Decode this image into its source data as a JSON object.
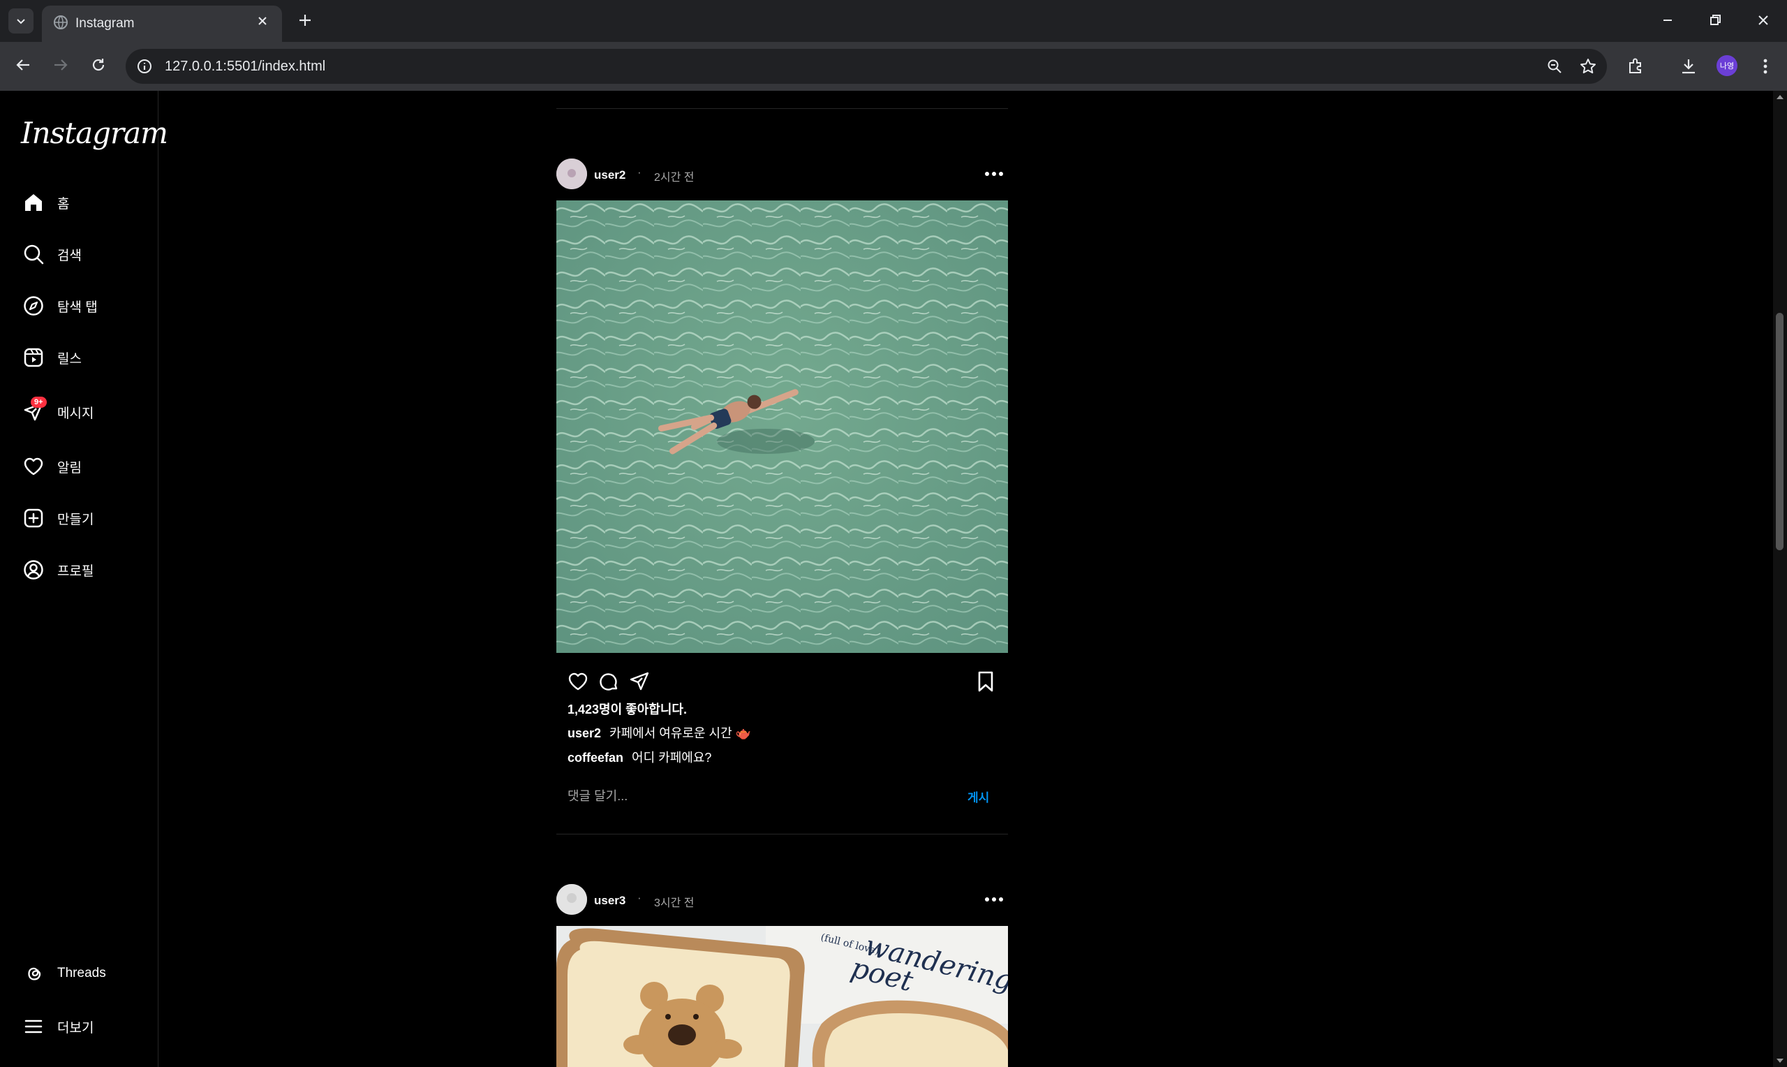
{
  "browser": {
    "tab_title": "Instagram",
    "url": "127.0.0.1:5501/index.html",
    "profile_initials": "나영"
  },
  "sidebar": {
    "logo": "Instagram",
    "items": [
      {
        "label": "홈",
        "icon": "home-icon"
      },
      {
        "label": "검색",
        "icon": "search-icon"
      },
      {
        "label": "탐색 탭",
        "icon": "compass-icon"
      },
      {
        "label": "릴스",
        "icon": "reels-icon"
      },
      {
        "label": "메시지",
        "icon": "send-icon",
        "badge": "9+"
      },
      {
        "label": "알림",
        "icon": "heart-icon"
      },
      {
        "label": "만들기",
        "icon": "plus-square-icon"
      },
      {
        "label": "프로필",
        "icon": "profile-icon"
      }
    ],
    "bottom": [
      {
        "label": "Threads",
        "icon": "threads-icon"
      },
      {
        "label": "더보기",
        "icon": "menu-icon"
      }
    ]
  },
  "posts": [
    {
      "username": "user2",
      "dot": "·",
      "time": "2시간 전",
      "likes": "1,423명이 좋아합니다.",
      "caption_user": "user2",
      "caption": "카페에서 여유로운 시간 🫖",
      "comments": [
        {
          "user": "coffeefan",
          "text": "어디 카페에요?"
        }
      ],
      "comment_placeholder": "댓글 달기...",
      "post_button": "게시"
    },
    {
      "username": "user3",
      "dot": "·",
      "time": "3시간 전",
      "image_text": [
        "wandering",
        "(full of love)",
        "poet"
      ]
    }
  ],
  "colors": {
    "accent": "#0095f6",
    "badge": "#ff3040",
    "background": "#000000"
  }
}
